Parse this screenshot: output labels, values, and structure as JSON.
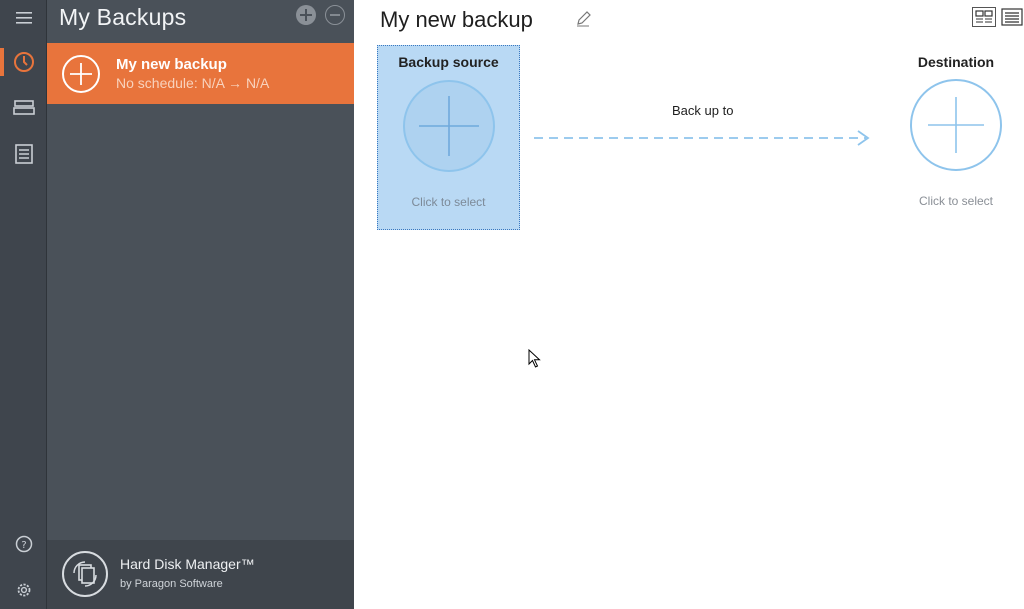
{
  "rail": {
    "icons": [
      "hamburger-menu-icon",
      "clock-icon",
      "drives-icon",
      "log-list-icon",
      "help-icon",
      "gear-icon"
    ]
  },
  "panel": {
    "title": "My Backups",
    "items": [
      {
        "name": "My new backup",
        "schedule": "No schedule: N/A → N/A"
      }
    ],
    "footer": {
      "product": "Hard Disk Manager™",
      "vendor": "by Paragon Software"
    }
  },
  "main": {
    "title": "My new backup",
    "source": {
      "title": "Backup source",
      "hint": "Click to select"
    },
    "arrow_label": "Back up to",
    "destination": {
      "title": "Destination",
      "hint": "Click to select"
    }
  },
  "colors": {
    "accent": "#e8743c",
    "rail_bg": "#3f454d",
    "panel_bg": "#4a5159",
    "selection_bg": "#b9d9f4",
    "circle_stroke": "#8ec4ec"
  }
}
